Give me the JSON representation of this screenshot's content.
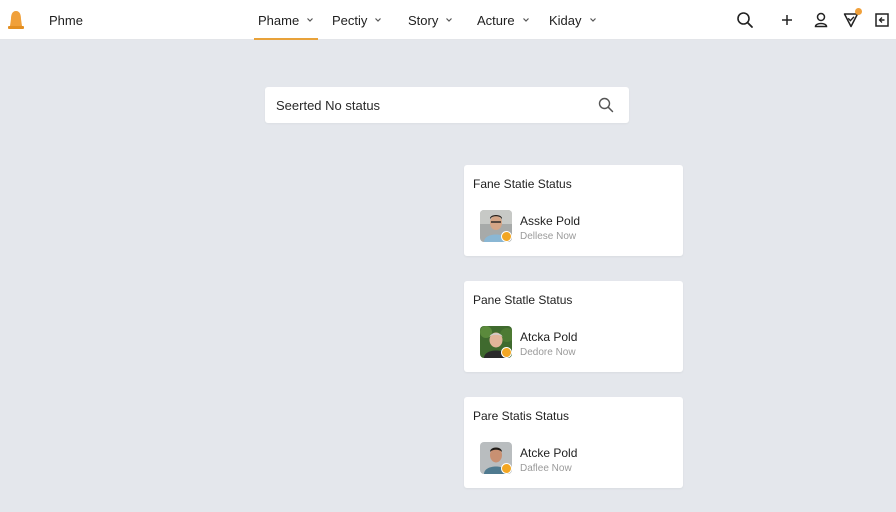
{
  "header": {
    "brand_name": "Phme",
    "tabs": [
      {
        "label": "Phame",
        "active": true
      },
      {
        "label": "Pectiy",
        "active": false
      },
      {
        "label": "Story",
        "active": false
      },
      {
        "label": "Acture",
        "active": false
      },
      {
        "label": "Kiday",
        "active": false
      }
    ],
    "icons": [
      "search-icon",
      "plus-icon",
      "user-icon",
      "notification-icon",
      "exit-icon"
    ],
    "accent_color": "#e8a23a"
  },
  "search": {
    "value": "Seerted No status"
  },
  "cards": [
    {
      "title": "Fane Statie Status",
      "user_name": "Asske Pold",
      "user_sub": "Dellese Now"
    },
    {
      "title": "Pane Statle Status",
      "user_name": "Atcka Pold",
      "user_sub": "Dedore Now"
    },
    {
      "title": "Pare Statis Status",
      "user_name": "Atcke Pold",
      "user_sub": "Daflee Now"
    }
  ],
  "status_color": "#f2a623"
}
